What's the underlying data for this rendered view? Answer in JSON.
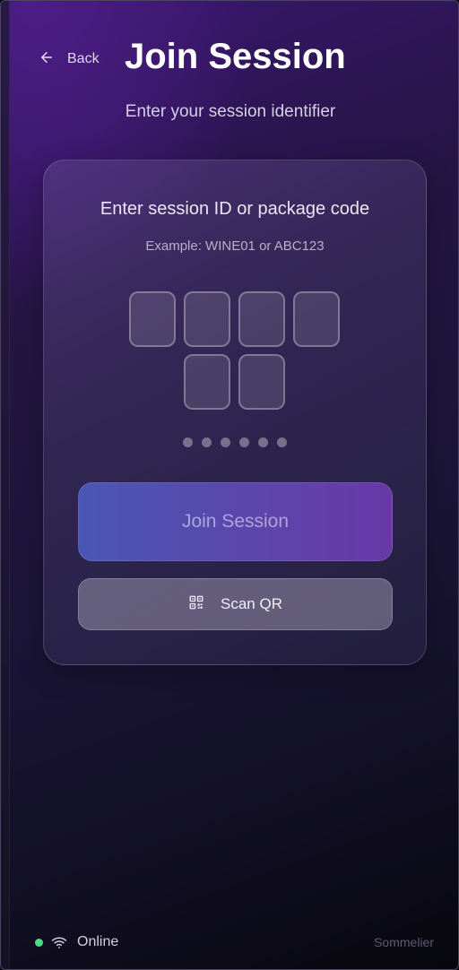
{
  "header": {
    "back_label": "Back",
    "title": "Join Session",
    "subtitle": "Enter your session identifier"
  },
  "card": {
    "title": "Enter session ID or package code",
    "hint": "Example: WINE01 or ABC123",
    "code_slots": [
      "",
      "",
      "",
      "",
      "",
      ""
    ],
    "dot_count": 6,
    "join_label": "Join Session",
    "scan_label": "Scan QR"
  },
  "footer": {
    "status": "Online",
    "brand": "Sommelier"
  },
  "colors": {
    "status_online": "#4ade80",
    "join_gradient_start": "#4a57b4",
    "join_gradient_end": "#6838a8"
  },
  "icons": {
    "back": "arrow-left-icon",
    "scan": "qr-code-icon",
    "status": "wifi-icon"
  }
}
